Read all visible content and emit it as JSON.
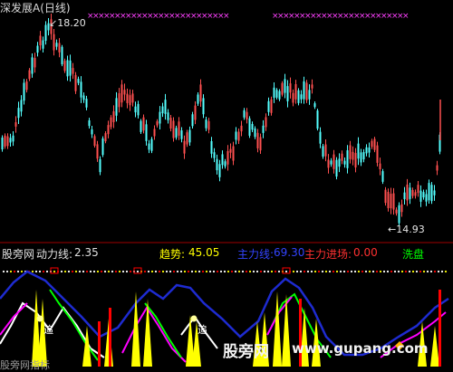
{
  "title": "深发展A(日线)",
  "price_annotations": {
    "high": "18.20",
    "low": "14.93"
  },
  "indicator_header": {
    "site": "股旁网",
    "power_line_label": "动力线:",
    "power_line_value": "2.35",
    "trend_label": "趋势:",
    "trend_value": "45.05",
    "main_force_line_label": "主力线:",
    "main_force_line_value": "69.30",
    "main_force_entry_label": "主力进场:",
    "main_force_entry_value": "0.00",
    "wash_label": "洗盘"
  },
  "markers": {
    "chase": "追"
  },
  "watermark": {
    "cn": "股旁网",
    "url": "www.gupang.com",
    "bottom_left": "股旁网指标"
  },
  "colors": {
    "background": "#000000",
    "candle_up": "#ff5050",
    "candle_down": "#54ffff",
    "marker_pink": "#ff40ff",
    "trend_line": "#1e2bd0",
    "power_white": "#ffffff",
    "power_green": "#00ff00",
    "power_magenta": "#ff00ff",
    "yellow": "#ffff00",
    "red": "#ff0000",
    "divider": "#a00000"
  }
}
